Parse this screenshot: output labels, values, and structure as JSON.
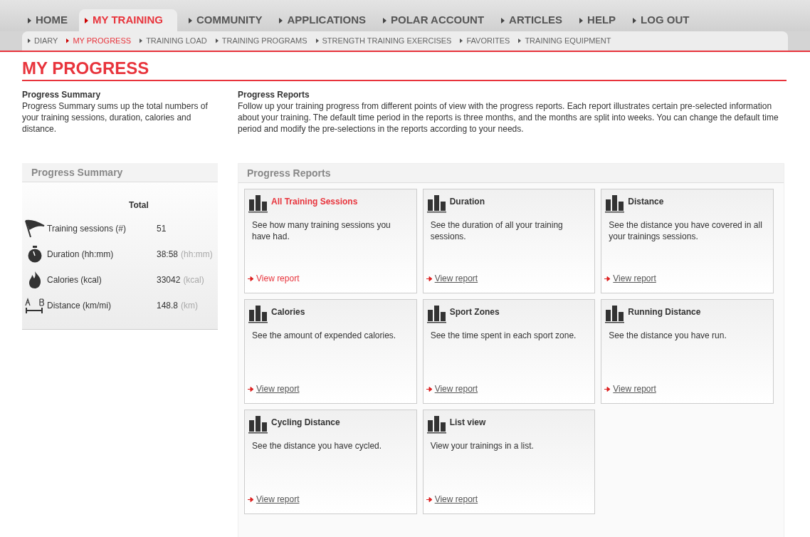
{
  "main_nav": [
    {
      "label": "HOME",
      "selected": false
    },
    {
      "label": "MY TRAINING",
      "selected": true
    },
    {
      "label": "COMMUNITY",
      "selected": false
    },
    {
      "label": "APPLICATIONS",
      "selected": false
    },
    {
      "label": "POLAR ACCOUNT",
      "selected": false
    },
    {
      "label": "ARTICLES",
      "selected": false
    },
    {
      "label": "HELP",
      "selected": false
    },
    {
      "label": "LOG OUT",
      "selected": false
    }
  ],
  "sub_nav": [
    {
      "label": "DIARY",
      "selected": false
    },
    {
      "label": "MY PROGRESS",
      "selected": true
    },
    {
      "label": "TRAINING LOAD",
      "selected": false
    },
    {
      "label": "TRAINING PROGRAMS",
      "selected": false
    },
    {
      "label": "STRENGTH TRAINING EXERCISES",
      "selected": false
    },
    {
      "label": "FAVORITES",
      "selected": false
    },
    {
      "label": "TRAINING EQUIPMENT",
      "selected": false
    }
  ],
  "page_title": "MY PROGRESS",
  "intro": [
    {
      "heading": "Progress Summary",
      "text": "Progress Summary sums up the total numbers of your training sessions, duration, calories and distance."
    },
    {
      "heading": "Progress Reports",
      "text": "Follow up your training progress from different points of view with the progress reports. Each report illustrates certain pre-selected information about your training. The default time period in the reports is three months, and the months are split into weeks. You can change the default time period and modify the pre-selections in the reports according to your needs."
    }
  ],
  "summary": {
    "title": "Progress Summary",
    "column": "Total",
    "rows": [
      {
        "label": "Training sessions (#)",
        "value": "51"
      },
      {
        "label": "Duration (hh:mm)",
        "value": "38:58",
        "unit": "(hh:mm)"
      },
      {
        "label": "Calories (kcal)",
        "value": "33042",
        "unit": "(kcal)"
      },
      {
        "label": "Distance (km/mi)",
        "value": "148.8",
        "unit": "(km)"
      }
    ]
  },
  "reports": {
    "title": "Progress Reports",
    "cards": [
      {
        "title": "All Training Sessions",
        "text": "See how many training sessions you have had.",
        "link": "View report",
        "hovered": true
      },
      {
        "title": "Duration",
        "text": "See the duration of all your training sessions.",
        "link": "View report",
        "hovered": false
      },
      {
        "title": "Distance",
        "text": "See the distance you have covered in all your trainings sessions.",
        "link": "View report",
        "hovered": false
      },
      {
        "title": "Calories",
        "text": "See the amount of expended calories.",
        "link": "View report",
        "hovered": false
      },
      {
        "title": "Sport Zones",
        "text": "See the time spent in each sport zone.",
        "link": "View report",
        "hovered": false
      },
      {
        "title": "Running Distance",
        "text": "See the distance you have run.",
        "link": "View report",
        "hovered": false
      },
      {
        "title": "Cycling Distance",
        "text": "See the distance you have cycled.",
        "link": "View report",
        "hovered": false
      },
      {
        "title": "List view",
        "text": "View your trainings in a list.",
        "link": "View report",
        "hovered": false
      }
    ]
  }
}
